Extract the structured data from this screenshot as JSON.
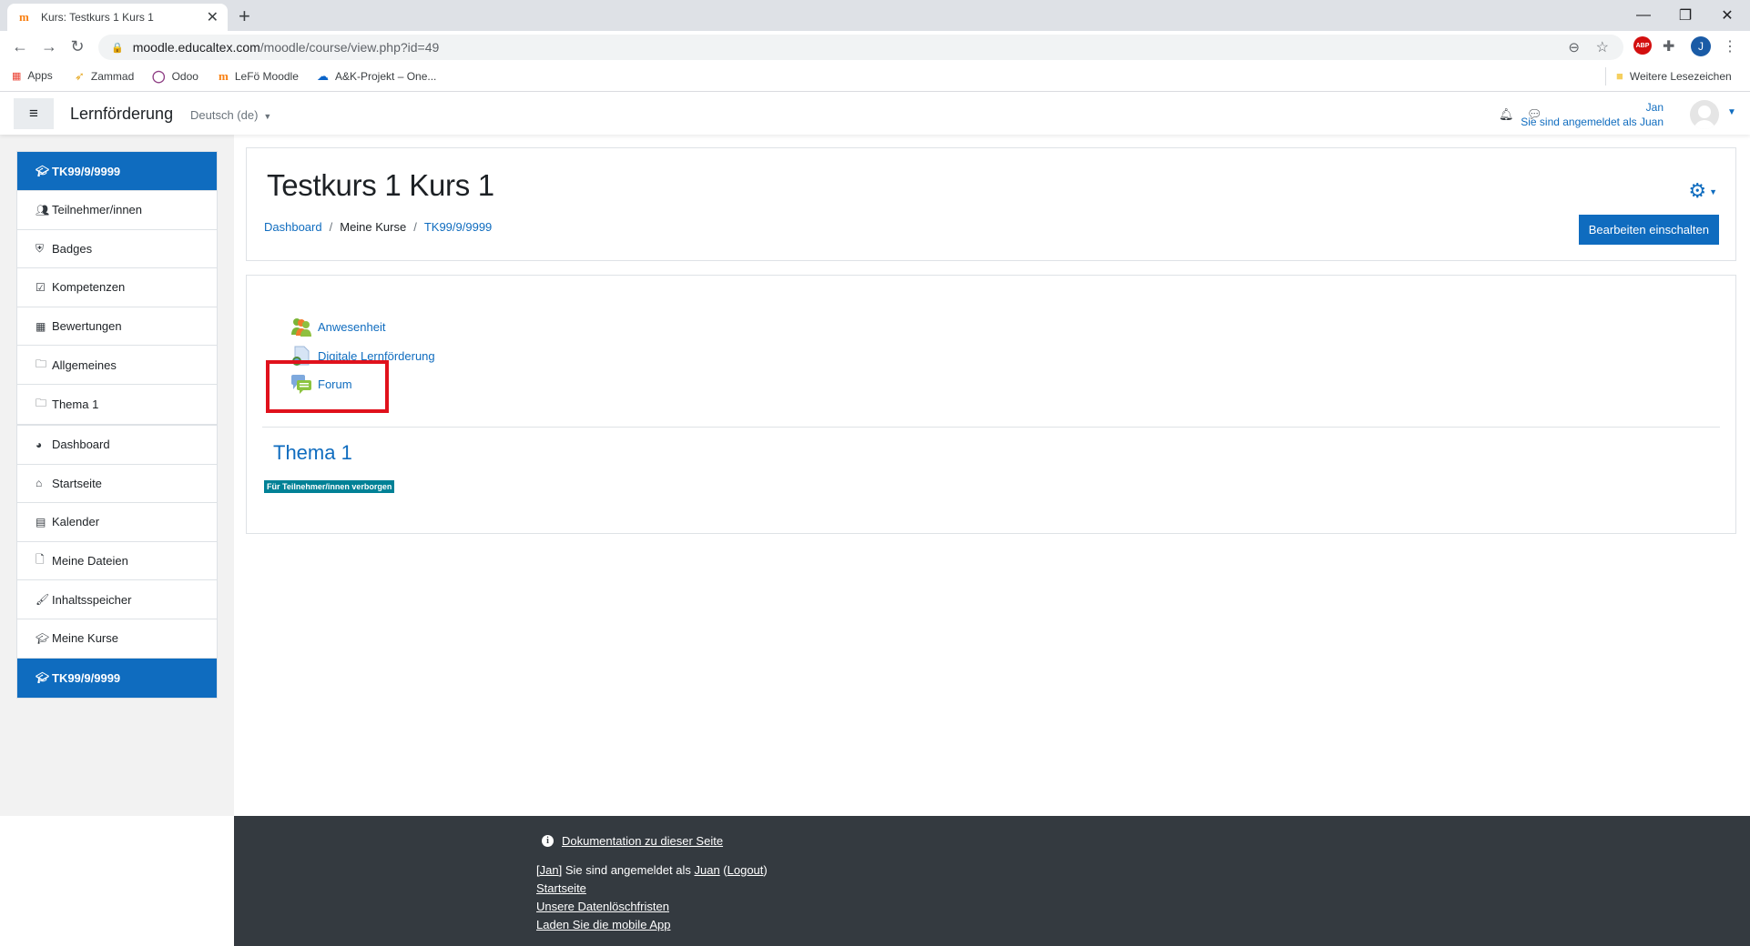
{
  "browser": {
    "tab_title": "Kurs: Testkurs 1 Kurs 1",
    "url_host": "moodle.educaltex.com",
    "url_path": "/moodle/course/view.php?id=49",
    "bookmarks": [
      {
        "label": "Apps",
        "icon": "apps-grid-icon"
      },
      {
        "label": "Zammad",
        "icon": "zammad-icon"
      },
      {
        "label": "Odoo",
        "icon": "odoo-icon"
      },
      {
        "label": "LeFö Moodle",
        "icon": "moodle-icon"
      },
      {
        "label": "A&K-Projekt – One...",
        "icon": "onedrive-icon"
      }
    ],
    "other_bookmarks": "Weitere Lesezeichen",
    "profile_initial": "J",
    "abp_label": "ABP"
  },
  "navbar": {
    "brand": "Lernförderung",
    "language": "Deutsch (de)",
    "user_name": "Jan",
    "login_as": "Sie sind angemeldet als Juan"
  },
  "drawer": {
    "course_items": [
      {
        "label": "TK99/9/9999",
        "icon": "graduation-cap-icon",
        "active": true
      },
      {
        "label": "Teilnehmer/innen",
        "icon": "users-icon"
      },
      {
        "label": "Badges",
        "icon": "shield-icon"
      },
      {
        "label": "Kompetenzen",
        "icon": "check-square-icon"
      },
      {
        "label": "Bewertungen",
        "icon": "table-icon"
      },
      {
        "label": "Allgemeines",
        "icon": "folder-icon"
      },
      {
        "label": "Thema 1",
        "icon": "folder-icon"
      }
    ],
    "site_items": [
      {
        "label": "Dashboard",
        "icon": "dashboard-icon"
      },
      {
        "label": "Startseite",
        "icon": "home-icon"
      },
      {
        "label": "Kalender",
        "icon": "calendar-icon"
      },
      {
        "label": "Meine Dateien",
        "icon": "file-icon"
      },
      {
        "label": "Inhaltsspeicher",
        "icon": "paint-brush-icon"
      },
      {
        "label": "Meine Kurse",
        "icon": "graduation-cap-icon"
      },
      {
        "label": "TK99/9/9999",
        "icon": "graduation-cap-icon",
        "active": true
      }
    ]
  },
  "header": {
    "title": "Testkurs 1 Kurs 1",
    "breadcrumb": [
      "Dashboard",
      "Meine Kurse",
      "TK99/9/9999"
    ],
    "edit_button": "Bearbeiten einschalten"
  },
  "course": {
    "activities": [
      {
        "label": "Anwesenheit",
        "icon": "attendance-icon"
      },
      {
        "label": "Digitale Lernförderung",
        "icon": "page-icon"
      },
      {
        "label": "Forum",
        "icon": "forum-icon",
        "highlighted": true
      }
    ],
    "section_title": "Thema 1",
    "hidden_badge": "Für Teilnehmer/innen verborgen"
  },
  "footer": {
    "doc_link": "Dokumentation zu dieser Seite",
    "login_user": "Jan",
    "login_text": " Sie sind angemeldet als ",
    "login_as": "Juan",
    "logout": "Logout",
    "links": [
      "Startseite",
      "Unsere Datenlöschfristen",
      "Laden Sie die mobile App"
    ]
  },
  "colors": {
    "accent": "#0f6cbf",
    "badge": "#008196",
    "highlight": "#e0111c",
    "footer_bg": "#343a40"
  }
}
